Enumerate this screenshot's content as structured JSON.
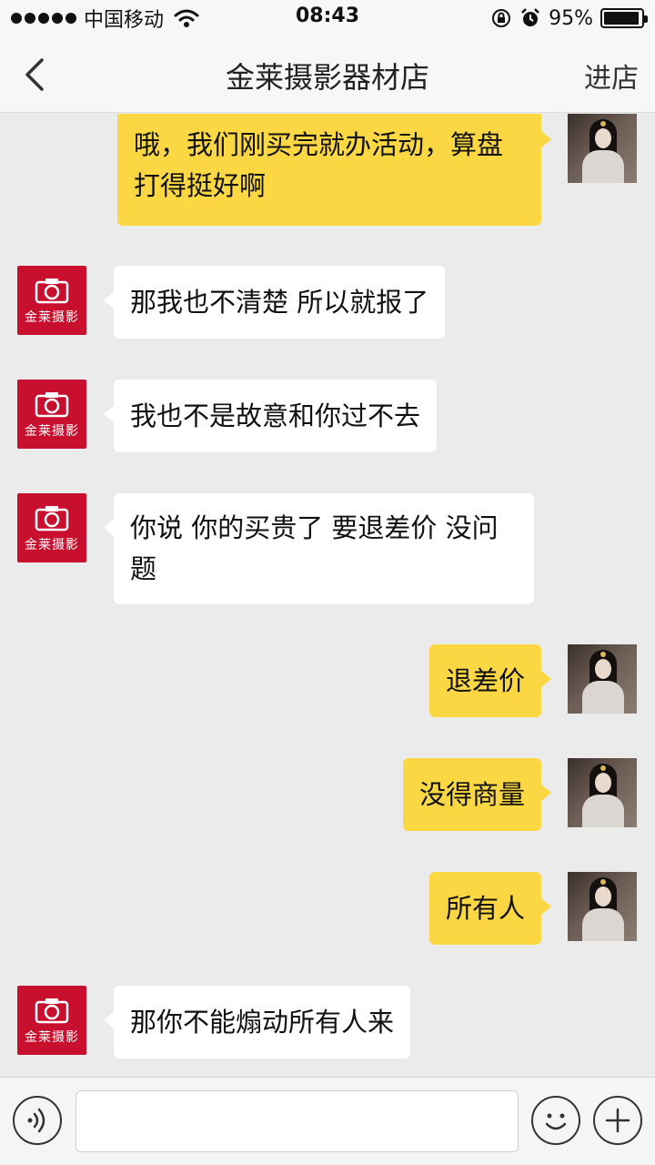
{
  "status_bar": {
    "carrier": "中国移动",
    "time": "08:43",
    "battery_percent": "95%",
    "battery_level": 0.95,
    "icons": [
      "signal-dots-icon",
      "wifi-icon",
      "rotation-lock-icon",
      "alarm-icon",
      "battery-icon"
    ]
  },
  "nav": {
    "title": "金莱摄影器材店",
    "right_action": "进店",
    "back_icon": "chevron-left-icon"
  },
  "shop_avatar": {
    "logo_text": "金莱摄影",
    "color": "#c8102e"
  },
  "messages": [
    {
      "from": "me",
      "text": "哦，我们刚买完就办活动，算盘打得挺好啊"
    },
    {
      "from": "shop",
      "text": "那我也不清楚 所以就报了"
    },
    {
      "from": "shop",
      "text": "我也不是故意和你过不去"
    },
    {
      "from": "shop",
      "text": "你说 你的买贵了 要退差价 没问题"
    },
    {
      "from": "me",
      "text": "退差价"
    },
    {
      "from": "me",
      "text": "没得商量"
    },
    {
      "from": "me",
      "text": "所有人"
    },
    {
      "from": "shop",
      "text": "那你不能煽动所有人来"
    }
  ],
  "colors": {
    "outgoing_bubble": "#fbd843",
    "incoming_bubble": "#ffffff",
    "background": "#ebebeb"
  },
  "input_bar": {
    "placeholder": "",
    "icons": [
      "voice-icon",
      "emoji-icon",
      "plus-icon"
    ]
  }
}
